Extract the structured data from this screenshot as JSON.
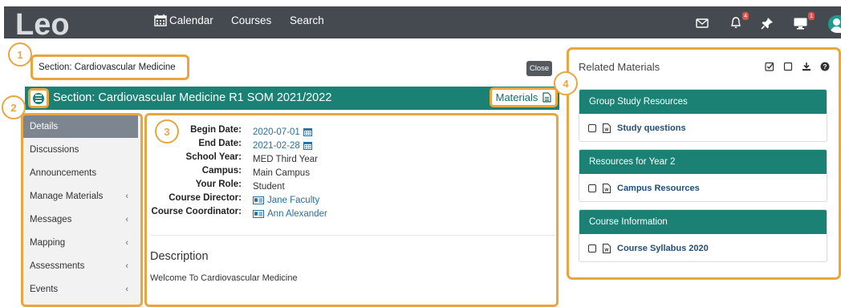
{
  "app": {
    "logo_text": "Leo"
  },
  "topnav": {
    "items": [
      {
        "label": "Calendar",
        "icon": "calendar-icon"
      },
      {
        "label": "Courses"
      },
      {
        "label": "Search"
      }
    ],
    "icons": [
      {
        "name": "mail-icon"
      },
      {
        "name": "bell-icon",
        "badge": "4"
      },
      {
        "name": "pin-icon"
      },
      {
        "name": "monitor-icon",
        "badge": "1"
      },
      {
        "name": "user-avatar"
      }
    ]
  },
  "callouts": [
    "1",
    "2",
    "3",
    "4"
  ],
  "section_title": "Section: Cardiovascular Medicine",
  "close_label": "Close",
  "header": {
    "title": "Section: Cardiovascular Medicine R1 SOM 2021/2022",
    "materials_label": "Materials"
  },
  "sidebar": {
    "items": [
      {
        "label": "Details",
        "active": true,
        "chevron": ""
      },
      {
        "label": "Discussions",
        "chevron": ""
      },
      {
        "label": "Announcements",
        "chevron": ""
      },
      {
        "label": "Manage Materials",
        "chevron": "‹"
      },
      {
        "label": "Messages",
        "chevron": "‹"
      },
      {
        "label": "Mapping",
        "chevron": "‹"
      },
      {
        "label": "Assessments",
        "chevron": "‹"
      },
      {
        "label": "Events",
        "chevron": "‹"
      }
    ]
  },
  "details": {
    "rows": [
      {
        "label": "Begin Date:",
        "value": "2020-07-01"
      },
      {
        "label": "End Date:",
        "value": "2021-02-28"
      },
      {
        "label": "School Year:",
        "value": "MED Third Year"
      },
      {
        "label": "Campus:",
        "value": "Main Campus"
      },
      {
        "label": "Your Role:",
        "value": "Student"
      },
      {
        "label": "Course Director:",
        "value": "Jane Faculty"
      },
      {
        "label": "Course Coordinator:",
        "value": "Ann Alexander"
      }
    ],
    "description_title": "Description",
    "description_text": "Welcome To Cardiovascular Medicine"
  },
  "related": {
    "title": "Related Materials",
    "tools": [
      "check-square-icon",
      "square-icon",
      "download-icon",
      "help-icon"
    ],
    "groups": [
      {
        "title": "Group Study Resources",
        "item": "Study questions"
      },
      {
        "title": "Resources for Year 2",
        "item": "Campus Resources"
      },
      {
        "title": "Course Information",
        "item": "Course Syllabus 2020"
      }
    ]
  },
  "colors": {
    "topbar": "#444a4f",
    "teal": "#1a8174",
    "callout_orange": "#e9a640",
    "link_blue": "#2a6f9e",
    "active_item": "#7c8590"
  }
}
